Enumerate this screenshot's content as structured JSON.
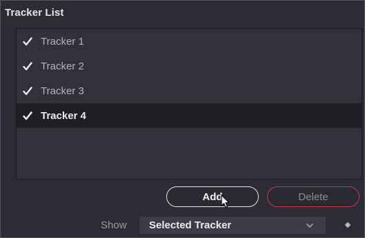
{
  "panel": {
    "title": "Tracker List"
  },
  "tracker_list": {
    "items": [
      {
        "label": "Tracker 1",
        "checked": true,
        "selected": false
      },
      {
        "label": "Tracker 2",
        "checked": true,
        "selected": false
      },
      {
        "label": "Tracker 3",
        "checked": true,
        "selected": false
      },
      {
        "label": "Tracker 4",
        "checked": true,
        "selected": true
      }
    ]
  },
  "buttons": {
    "add_label": "Add",
    "delete_label": "Delete"
  },
  "show": {
    "label": "Show",
    "selected_value": "Selected Tracker"
  },
  "icons": {
    "check": "checkmark-icon",
    "chevron": "chevron-down-icon",
    "keyframe": "keyframe-diamond-icon",
    "cursor": "mouse-pointer-icon"
  },
  "colors": {
    "background": "#2c2d34",
    "list_background": "#30313a",
    "selected_row": "#1e1f25",
    "delete_border": "#d03a44",
    "add_border": "#e9e9ec"
  }
}
